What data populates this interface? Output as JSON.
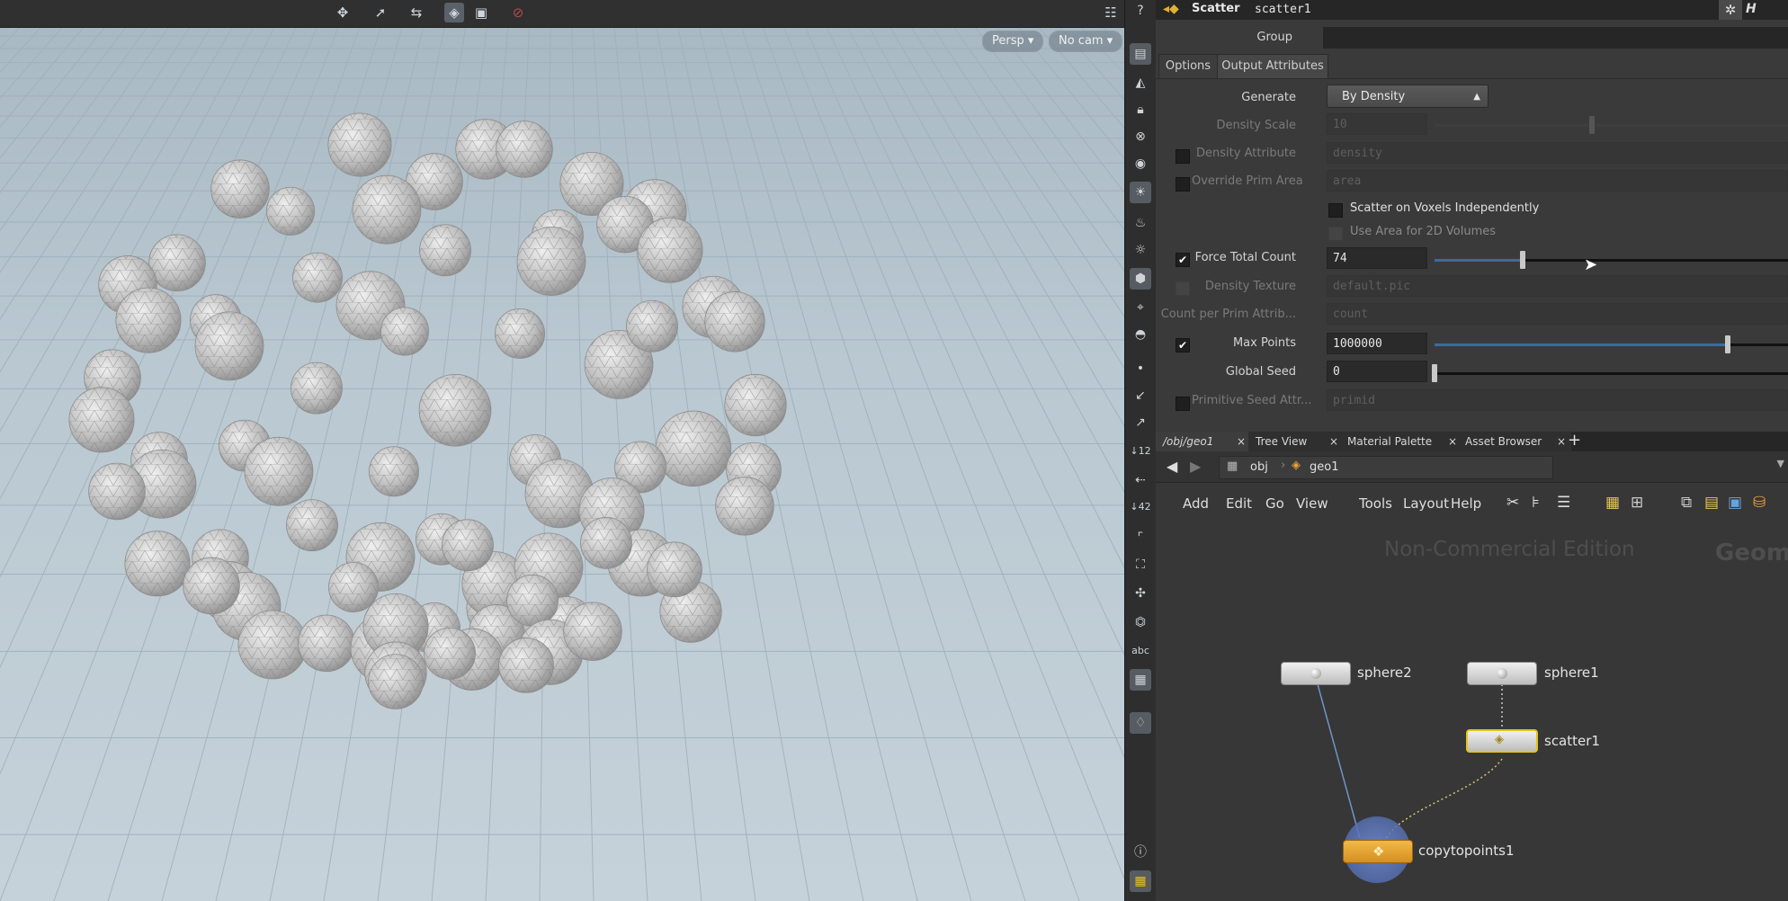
{
  "viewport": {
    "camera_view": "Persp",
    "camera": "No cam"
  },
  "params": {
    "node_type": "Scatter",
    "node_name": "scatter1",
    "group_label": "Group",
    "tabs": [
      "Options",
      "Output Attributes"
    ],
    "rows": {
      "generate": {
        "label": "Generate",
        "value": "By Density"
      },
      "density_scale": {
        "label": "Density Scale",
        "value": "10"
      },
      "density_attribute": {
        "label": "Density Attribute",
        "value": "density"
      },
      "override_prim_area": {
        "label": "Override Prim Area",
        "value": "area"
      },
      "scatter_on_voxels": {
        "label": "Scatter on Voxels Independently"
      },
      "use_area_2d": {
        "label": "Use Area for 2D Volumes"
      },
      "force_total_count": {
        "label": "Force Total Count",
        "value": "74",
        "check": "✔"
      },
      "density_texture": {
        "label": "Density Texture",
        "value": "default.pic"
      },
      "count_per_prim": {
        "label": "Count per Prim Attrib...",
        "value": "count"
      },
      "max_points": {
        "label": "Max Points",
        "value": "1000000",
        "check": "✔"
      },
      "global_seed": {
        "label": "Global Seed",
        "value": "0"
      },
      "primitive_seed": {
        "label": "Primitive Seed Attr...",
        "value": "primid"
      }
    },
    "force_total_count_level": 0.25,
    "max_points_level": 0.83,
    "global_seed_level": 0.0
  },
  "network": {
    "tabs": [
      "/obj/geo1",
      "Tree View",
      "Material Palette",
      "Asset Browser"
    ],
    "tab_close": "×",
    "add_tab": "+",
    "path": [
      "obj",
      "geo1"
    ],
    "menu": [
      "Add",
      "Edit",
      "Go",
      "View",
      "Tools",
      "Layout",
      "Help"
    ],
    "watermark": "Non-Commercial Edition",
    "context_label": "Geom",
    "nodes": {
      "sphere2": "sphere2",
      "sphere1": "sphere1",
      "scatter1": "scatter1",
      "copytopoints1": "copytopoints1"
    }
  },
  "shelf": {
    "label_12": "12",
    "label_42": "42",
    "label_abc": "abc"
  },
  "colors": {
    "accent_blue": "#3d6a9e",
    "selected_node_border": "#e8c21a",
    "copy_node": "#e6a729"
  }
}
